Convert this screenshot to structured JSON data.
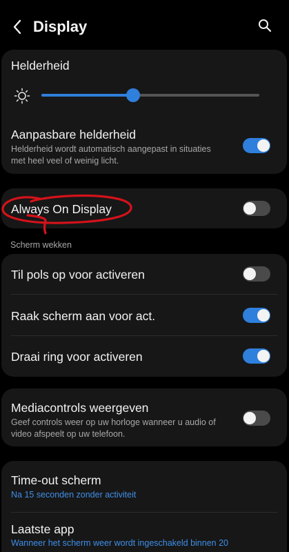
{
  "header": {
    "title": "Display",
    "back_icon": "chevron-left-icon",
    "search_icon": "search-icon"
  },
  "brightness": {
    "title": "Helderheid",
    "icon": "sun-icon",
    "level": 0.42
  },
  "adaptive_brightness": {
    "title": "Aanpasbare helderheid",
    "line1": "Helderheid wordt automatisch aangepast in situaties",
    "line2": "met heel veel of weinig licht.",
    "enabled": true
  },
  "always_on_display": {
    "title": "Always On Display",
    "enabled": false
  },
  "wake_screen": {
    "section_label": "Scherm wekken",
    "items": [
      {
        "label": "Til pols op voor activeren",
        "enabled": false
      },
      {
        "label": "Raak scherm aan voor act.",
        "enabled": true
      },
      {
        "label": "Draai ring voor activeren",
        "enabled": true
      }
    ]
  },
  "media_controls": {
    "title": "Mediacontrols weergeven",
    "line1": "Geef controls weer op uw horloge wanneer u audio of",
    "line2": "video afspeelt op uw telefoon.",
    "enabled": false
  },
  "timeout": {
    "title": "Time-out scherm",
    "value": "Na 15 seconden zonder activiteit"
  },
  "last_app": {
    "title": "Laatste app",
    "value": "Wanneer het scherm weer wordt ingeschakeld binnen 20"
  },
  "colors": {
    "accent": "#2f7fdc",
    "annotation": "#d4121a",
    "card": "#171717",
    "background": "#000000"
  }
}
